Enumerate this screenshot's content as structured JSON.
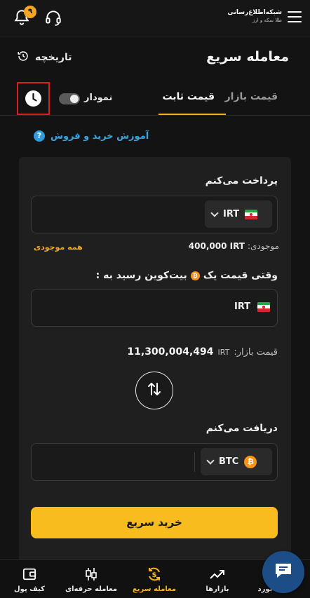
{
  "header": {
    "brand_line1": "شبکه‌اطلاع‌رسانی",
    "brand_line2": "طلا سکه و ارز",
    "notification_count": "۹"
  },
  "page": {
    "title": "معامله سریع",
    "history_label": "تاریخچه"
  },
  "tabs": [
    {
      "label": "قیمت بازار",
      "active": false
    },
    {
      "label": "قیمت ثابت",
      "active": true
    }
  ],
  "chart_toggle": {
    "label": "نمودار"
  },
  "tutorial": {
    "label": "آموزش خرید و فروش",
    "icon": "?"
  },
  "pay": {
    "label": "پرداخت می‌کنم",
    "currency": "IRT",
    "balance_label": "موجودی:",
    "balance_value": "400,000 IRT",
    "all_balance": "همه موجودی"
  },
  "price_when": {
    "label_before": "وقتی قیمت یک",
    "label_after": "بیت‌کوین رسید به :",
    "currency": "IRT"
  },
  "market_price": {
    "label": "قیمت بازار:",
    "unit": "IRT",
    "value": "11,300,004,494"
  },
  "receive": {
    "label": "دریافت می‌کنم",
    "currency": "BTC"
  },
  "buy_button": "خرید سریع",
  "bottom_nav": [
    {
      "label": "کیف پول",
      "icon": "wallet-icon",
      "active": false
    },
    {
      "label": "معامله حرفه‌ای",
      "icon": "candles-icon",
      "active": false
    },
    {
      "label": "معامله سریع",
      "icon": "quick-trade-icon",
      "active": true
    },
    {
      "label": "بازارها",
      "icon": "trend-icon",
      "active": false
    },
    {
      "label": "بورد",
      "icon": "board-icon",
      "active": false
    }
  ],
  "colors": {
    "accent": "#f9bc1e",
    "link": "#3aa4e0",
    "background": "#131313"
  }
}
